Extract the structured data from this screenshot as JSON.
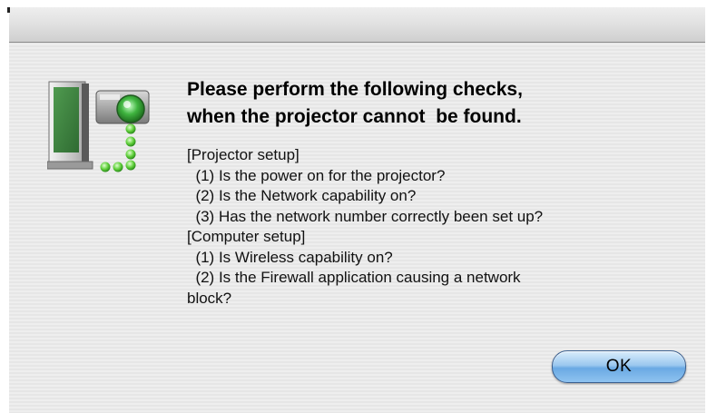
{
  "dialog": {
    "icon": "computer-projector-network-icon",
    "headline": [
      "Please perform the following checks,",
      "when the projector cannot  be found."
    ],
    "body": [
      "[Projector setup]",
      "  (1) Is the power on for the projector?",
      "  (2) Is the Network capability on?",
      "  (3) Has the network number correctly been set up?",
      "[Computer setup]",
      "  (1) Is Wireless capability on?",
      "  (2) Is the Firewall application causing a network",
      "block?"
    ],
    "ok_label": "OK"
  },
  "colors": {
    "accent": "#6aa9e3",
    "background": "#ececec"
  }
}
